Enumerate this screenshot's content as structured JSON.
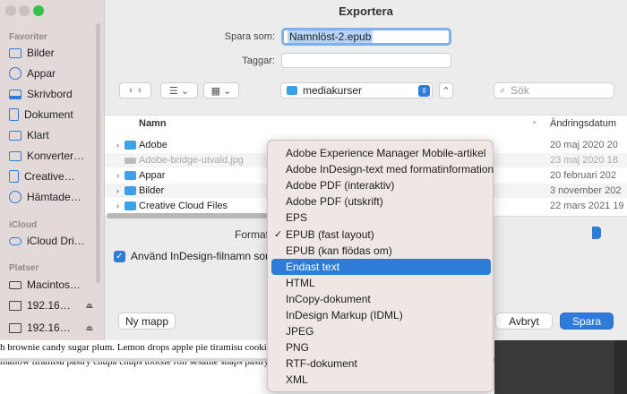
{
  "background_document": {
    "line1": "h brownie candy sugar plum. Lemon drops apple pie tiramisu cookie puddi",
    "line2": "mallow tiramisu pastry chupa chups tootsie roll sesame snaps pastry. Fruite"
  },
  "dialog": {
    "title": "Exportera",
    "save_as_label": "Spara som:",
    "save_as_value": "Namnlöst-2.epub",
    "tags_label": "Taggar:",
    "location": "mediakurser",
    "search_placeholder": "Sök",
    "columns": {
      "name": "Namn",
      "date": "Ändringsdatum"
    },
    "files": [
      {
        "name": "Adobe",
        "date": "20 maj 2020 20",
        "type": "folder"
      },
      {
        "name": "Adobe-bridge-utvald.jpg",
        "date": "23 maj 2020 18",
        "type": "file"
      },
      {
        "name": "Appar",
        "date": "20 februari 202",
        "type": "folder"
      },
      {
        "name": "Bilder",
        "date": "3 november 202",
        "type": "folder"
      },
      {
        "name": "Creative Cloud Files",
        "date": "22 mars 2021 19",
        "type": "folder"
      }
    ],
    "format_label": "Format",
    "checkbox_label": "Använd InDesign-filnamn som",
    "new_folder_button": "Ny mapp",
    "cancel_button": "Avbryt",
    "save_button": "Spara"
  },
  "sidebar": {
    "favorites_label": "Favoriter",
    "favorites": [
      {
        "label": "Bilder",
        "icon": "folder-icon"
      },
      {
        "label": "Appar",
        "icon": "apps-icon"
      },
      {
        "label": "Skrivbord",
        "icon": "desktop-icon"
      },
      {
        "label": "Dokument",
        "icon": "document-icon"
      },
      {
        "label": "Klart",
        "icon": "folder-icon"
      },
      {
        "label": "Konverter…",
        "icon": "folder-icon"
      },
      {
        "label": "Creative…",
        "icon": "document-icon"
      },
      {
        "label": "Hämtade…",
        "icon": "download-icon"
      }
    ],
    "icloud_label": "iCloud",
    "icloud": [
      {
        "label": "iCloud Dri…",
        "icon": "cloud-icon"
      }
    ],
    "places_label": "Platser",
    "places": [
      {
        "label": "Macintos…",
        "icon": "drive-icon"
      },
      {
        "label": "192.16…",
        "icon": "monitor-icon"
      },
      {
        "label": "192.16…",
        "icon": "monitor-icon"
      }
    ]
  },
  "format_menu": {
    "items": [
      {
        "label": "Adobe Experience Manager Mobile-artikel",
        "checked": false,
        "highlighted": false
      },
      {
        "label": "Adobe InDesign-text med formatinformation",
        "checked": false,
        "highlighted": false
      },
      {
        "label": "Adobe PDF (interaktiv)",
        "checked": false,
        "highlighted": false
      },
      {
        "label": "Adobe PDF (utskrift)",
        "checked": false,
        "highlighted": false
      },
      {
        "label": "EPS",
        "checked": false,
        "highlighted": false
      },
      {
        "label": "EPUB (fast layout)",
        "checked": true,
        "highlighted": false
      },
      {
        "label": "EPUB (kan flödas om)",
        "checked": false,
        "highlighted": false
      },
      {
        "label": "Endast text",
        "checked": false,
        "highlighted": true
      },
      {
        "label": "HTML",
        "checked": false,
        "highlighted": false
      },
      {
        "label": "InCopy-dokument",
        "checked": false,
        "highlighted": false
      },
      {
        "label": "InDesign Markup (IDML)",
        "checked": false,
        "highlighted": false
      },
      {
        "label": "JPEG",
        "checked": false,
        "highlighted": false
      },
      {
        "label": "PNG",
        "checked": false,
        "highlighted": false
      },
      {
        "label": "RTF-dokument",
        "checked": false,
        "highlighted": false
      },
      {
        "label": "XML",
        "checked": false,
        "highlighted": false
      }
    ],
    "check_glyph": "✓"
  },
  "colors": {
    "accent": "#2f7bd8",
    "sidebar": "#e3d9d9",
    "menu": "#efe7e4"
  }
}
